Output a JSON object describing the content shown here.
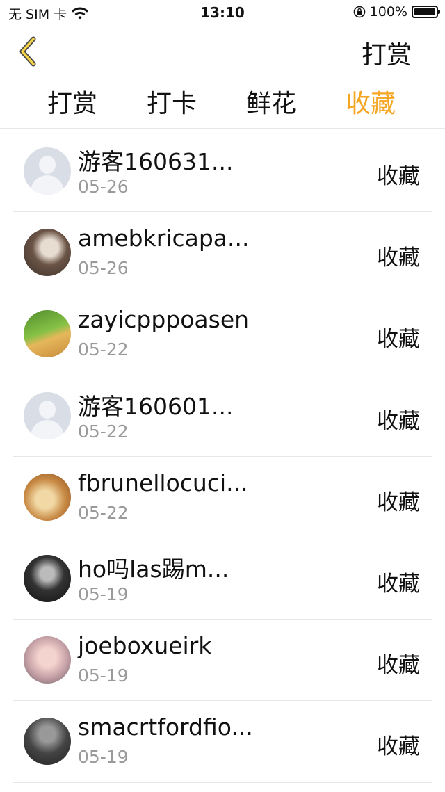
{
  "status_bar": {
    "carrier": "无 SIM 卡",
    "time": "13:10",
    "battery": "100%"
  },
  "navbar": {
    "title": "打赏"
  },
  "tabs": [
    {
      "label": "打赏",
      "active": false
    },
    {
      "label": "打卡",
      "active": false
    },
    {
      "label": "鲜花",
      "active": false
    },
    {
      "label": "收藏",
      "active": true
    }
  ],
  "accent_color": "#f5a623",
  "list": [
    {
      "name": "游客160631...",
      "date": "05-26",
      "action": "收藏",
      "avatar": "default-avatar"
    },
    {
      "name": "amebkricapa...",
      "date": "05-26",
      "action": "收藏",
      "avatar": "user-photo"
    },
    {
      "name": "zayicpppoasen",
      "date": "05-22",
      "action": "收藏",
      "avatar": "user-photo"
    },
    {
      "name": "游客160601...",
      "date": "05-22",
      "action": "收藏",
      "avatar": "default-avatar"
    },
    {
      "name": "fbrunellocuci...",
      "date": "05-22",
      "action": "收藏",
      "avatar": "user-photo"
    },
    {
      "name": "ho吗las踢m...",
      "date": "05-19",
      "action": "收藏",
      "avatar": "user-photo"
    },
    {
      "name": "joeboxueirk",
      "date": "05-19",
      "action": "收藏",
      "avatar": "user-photo"
    },
    {
      "name": "smacrtfordfio...",
      "date": "05-19",
      "action": "收藏",
      "avatar": "user-photo"
    }
  ]
}
